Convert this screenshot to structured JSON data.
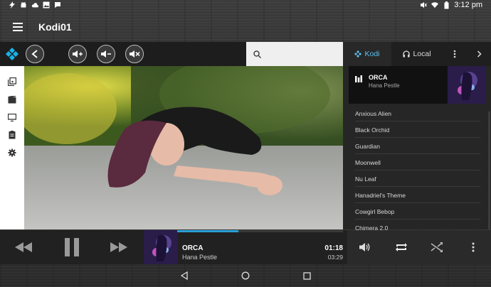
{
  "status": {
    "time": "3:12 pm",
    "left_icons": [
      "bolt-icon",
      "android-icon",
      "cloud-icon",
      "image-icon",
      "chat-icon"
    ],
    "right_icons": [
      "mute-icon",
      "wifi-icon",
      "battery-icon"
    ]
  },
  "appbar": {
    "title": "Kodi01"
  },
  "search": {
    "placeholder": ""
  },
  "tabs": {
    "kodi": "Kodi",
    "local": "Local"
  },
  "now_playing_card": {
    "title": "ORCA",
    "artist": "Hana Pestle"
  },
  "playlist": [
    "Anxious Alien",
    "Black Orchid",
    "Guardian",
    "Moonwell",
    "Nu Leaf",
    "Hanadriel's Theme",
    "Cowgirl Bebop",
    "Chimera 2.0"
  ],
  "player": {
    "title": "ORCA",
    "artist": "Hana Pestle",
    "elapsed": "01:18",
    "total": "03:29",
    "progress": 0.37
  },
  "colors": {
    "accent": "#2ba0d8",
    "tab_active": "#5bc2f0"
  }
}
